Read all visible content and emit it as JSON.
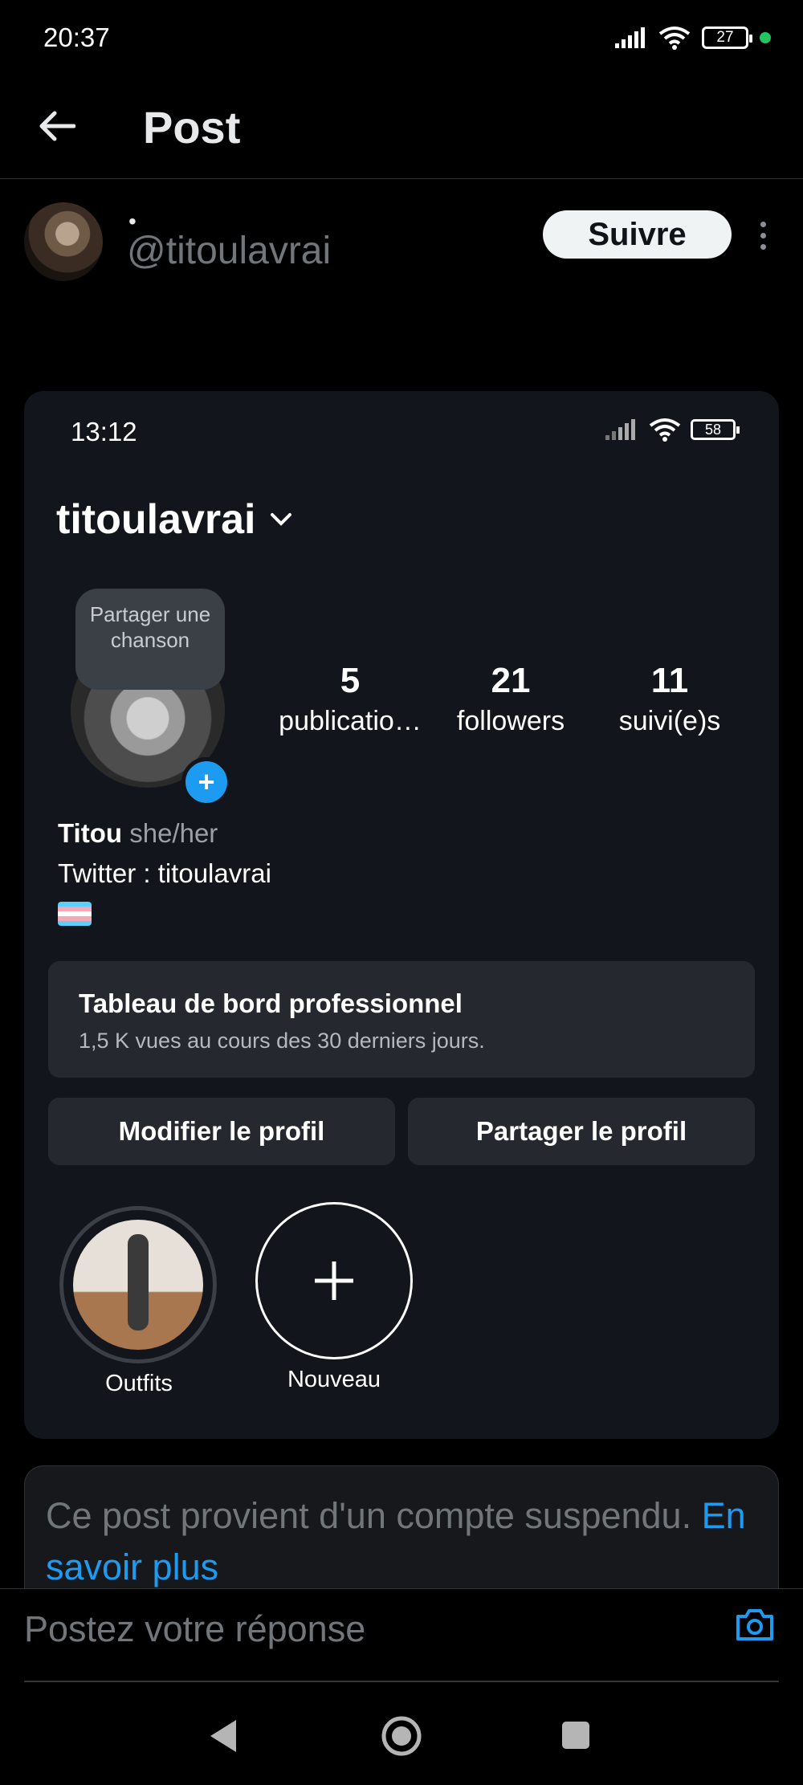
{
  "status_bar": {
    "time": "20:37",
    "battery": "27"
  },
  "header": {
    "title": "Post"
  },
  "author": {
    "name": "•",
    "handle": "@titoulavrai",
    "follow_label": "Suivre"
  },
  "embedded": {
    "time": "13:12",
    "battery": "58",
    "username": "titoulavrai",
    "bubble": "Partager une chanson",
    "stats": [
      {
        "value": "5",
        "label": "publicatio…"
      },
      {
        "value": "21",
        "label": "followers"
      },
      {
        "value": "11",
        "label": "suivi(e)s"
      }
    ],
    "bio": {
      "name": "Titou",
      "pronouns": "she/her",
      "line": "Twitter : titoulavrai"
    },
    "dashboard": {
      "title": "Tableau de bord professionnel",
      "subtitle": "1,5 K vues au cours des 30 derniers jours."
    },
    "edit_profile": "Modifier le profil",
    "share_profile": "Partager le profil",
    "highlights": [
      {
        "label": "Outfits"
      },
      {
        "label": "Nouveau"
      }
    ]
  },
  "notice": {
    "text": "Ce post provient d'un compte suspendu.",
    "link": "En savoir plus"
  },
  "reply": {
    "placeholder": "Postez votre réponse"
  },
  "colors": {
    "accent": "#1d9bf0",
    "background": "#000000",
    "card": "#12151b"
  }
}
